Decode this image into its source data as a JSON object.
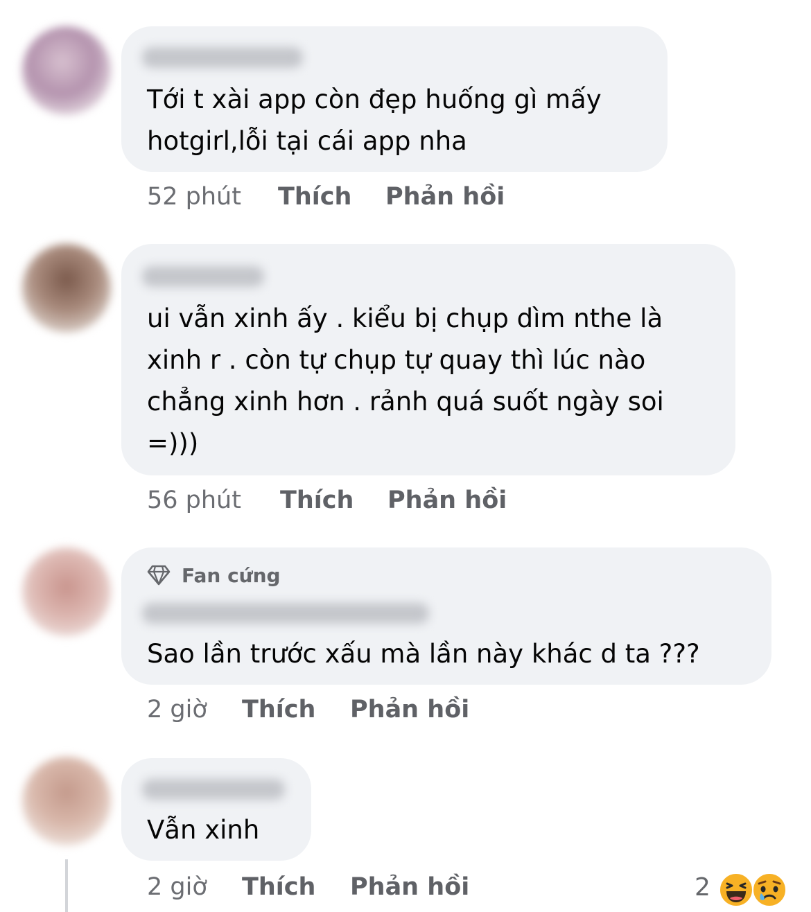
{
  "comments": [
    {
      "text_lines": [
        "Tới t xài app còn đẹp huống gì mấy",
        "hotgirl,lỗi tại cái app nha"
      ],
      "time": "52 phút",
      "like_label": "Thích",
      "reply_label": "Phản hồi"
    },
    {
      "text_lines": [
        "ui vẫn xinh ấy . kiểu bị chụp dìm nthe là",
        "xinh r . còn tự chụp tự quay thì lúc nào",
        "chẳng xinh hơn . rảnh quá suốt ngày soi",
        "=)))"
      ],
      "time": "56 phút",
      "like_label": "Thích",
      "reply_label": "Phản hồi"
    },
    {
      "badge": "Fan cứng",
      "badge_icon": "diamond-icon",
      "text_lines": [
        "Sao lần trước xấu mà lần này khác d ta ???"
      ],
      "time": "2 giờ",
      "like_label": "Thích",
      "reply_label": "Phản hồi"
    },
    {
      "text_lines": [
        "Vẫn xinh"
      ],
      "time": "2 giờ",
      "like_label": "Thích",
      "reply_label": "Phản hồi",
      "reactions": {
        "count": "2",
        "icons": [
          "haha-icon",
          "sad-icon"
        ]
      }
    }
  ],
  "colors": {
    "bubble": "#f0f2f5",
    "text": "#050505",
    "secondary": "#65676b",
    "emoji_yellow": "#f7b125"
  }
}
